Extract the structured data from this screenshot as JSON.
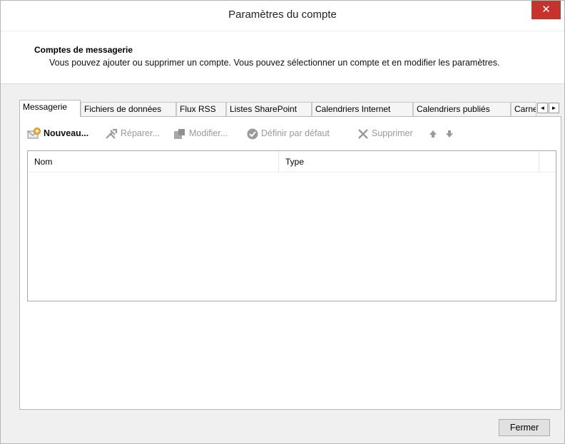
{
  "window": {
    "title": "Paramètres du compte",
    "close_glyph": "✕"
  },
  "header": {
    "title": "Comptes de messagerie",
    "description": "Vous pouvez ajouter ou supprimer un compte. Vous pouvez sélectionner un compte et en modifier les paramètres."
  },
  "tabs": [
    {
      "label": "Messagerie",
      "active": true
    },
    {
      "label": "Fichiers de données",
      "active": false
    },
    {
      "label": "Flux RSS",
      "active": false
    },
    {
      "label": "Listes SharePoint",
      "active": false
    },
    {
      "label": "Calendriers Internet",
      "active": false
    },
    {
      "label": "Calendriers publiés",
      "active": false
    },
    {
      "label": "Carnets d'adresses",
      "active": false
    }
  ],
  "tab_scroll": {
    "left": "◄",
    "right": "►"
  },
  "toolbar": {
    "new_label": "Nouveau...",
    "repair_label": "Réparer...",
    "modify_label": "Modifier...",
    "default_label": "Définir par défaut",
    "delete_label": "Supprimer",
    "up_label": "↑",
    "down_label": "↓",
    "icons": [
      "mail-new-icon",
      "repair-tools-icon",
      "modify-icon",
      "check-circle-icon",
      "delete-x-icon",
      "arrow-up-icon",
      "arrow-down-icon"
    ]
  },
  "list": {
    "columns": [
      "Nom",
      "Type"
    ],
    "rows": []
  },
  "footer": {
    "close_label": "Fermer"
  },
  "colors": {
    "close_button": "#c7332c",
    "body_background": "#f0f0f0",
    "disabled_text": "#9a9a9a"
  }
}
